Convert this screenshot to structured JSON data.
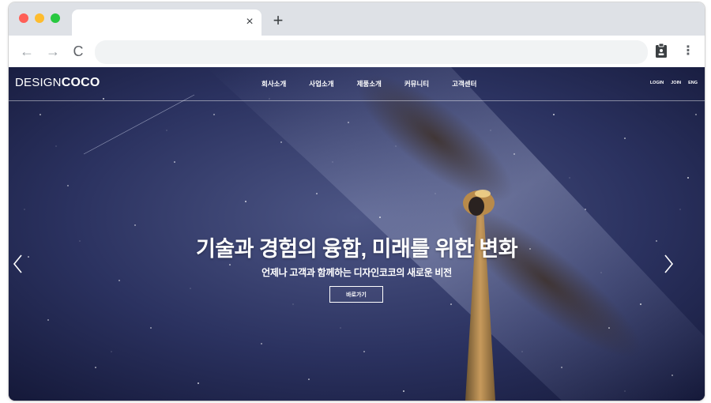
{
  "browser": {
    "tab": {
      "title": "",
      "close_glyph": "×"
    },
    "new_tab_glyph": "+",
    "toolbar": {
      "back_glyph": "←",
      "forward_glyph": "→",
      "reload_glyph": "C",
      "url": "",
      "menu_glyph": "⋮"
    }
  },
  "site": {
    "logo": {
      "thin": "DESIGN",
      "bold": "COCO"
    },
    "nav": [
      "회사소개",
      "사업소개",
      "제품소개",
      "커뮤니티",
      "고객센터"
    ],
    "util": [
      "LOGIN",
      "JOIN",
      "ENG"
    ]
  },
  "hero": {
    "title": "기술과 경험의 융합, 미래를 위한 변화",
    "subtitle": "언제나 고객과 함께하는 디자인코코의 새로운 비전",
    "button_label": "바로가기"
  }
}
